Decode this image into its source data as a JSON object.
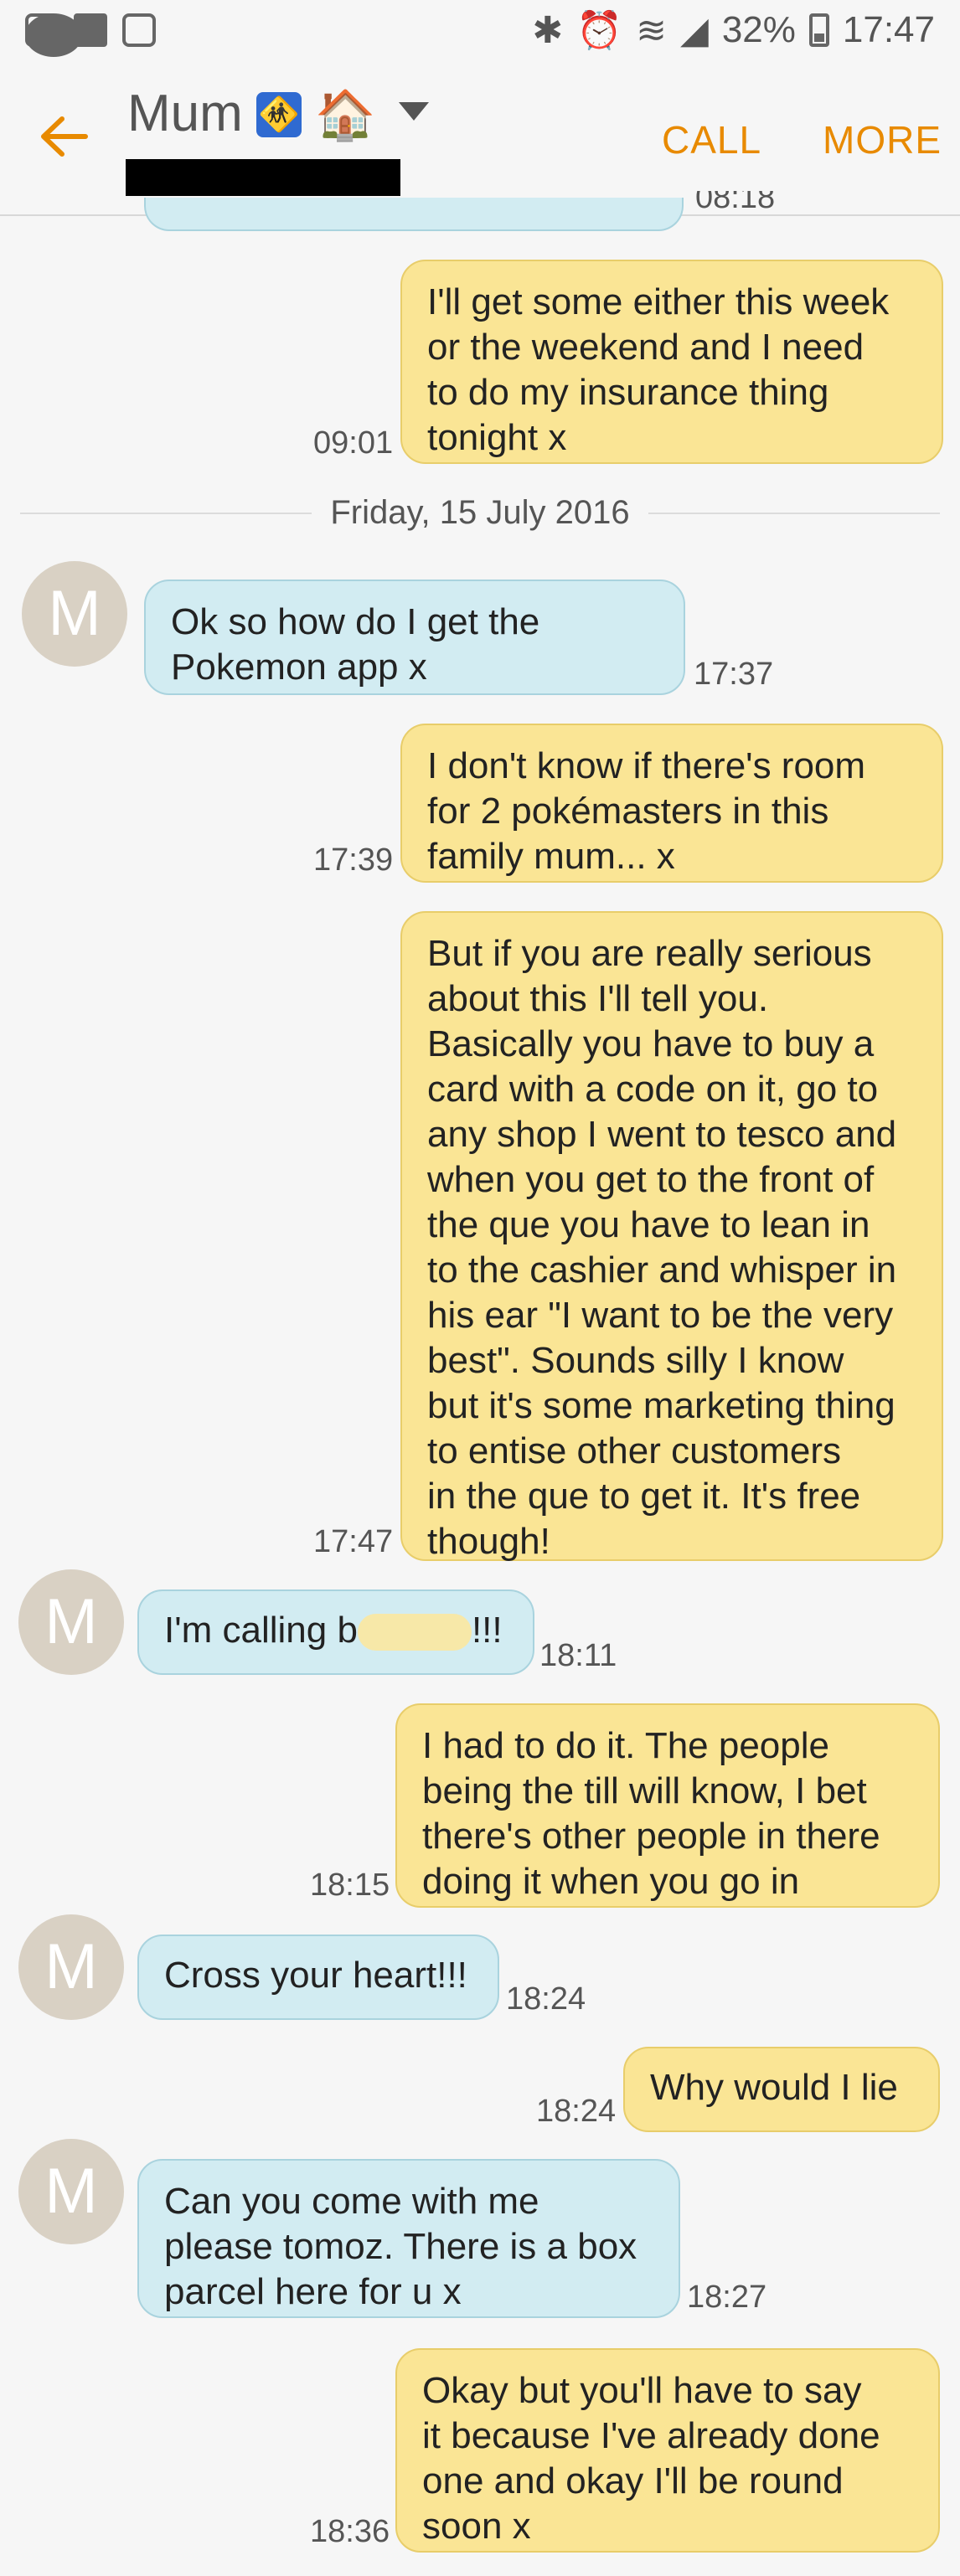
{
  "status_bar": {
    "battery": "32%",
    "time": "17:47",
    "icons": [
      "instagram-icon",
      "facebook-icon",
      "gallery-icon",
      "messenger-icon",
      "bluetooth-icon",
      "alarm-icon",
      "wifi-icon",
      "signal-icon",
      "battery-icon"
    ]
  },
  "header": {
    "contact_name": "Mum",
    "emoji_1": "🚸",
    "emoji_2": "🏠",
    "call_label": "CALL",
    "more_label": "MORE",
    "accent_color": "#e88a00"
  },
  "conversation": {
    "partial_time": "08:18",
    "date_separator": "Friday, 15 July 2016",
    "avatar_letter": "M",
    "messages": [
      {
        "dir": "out",
        "time": "09:01",
        "lines": [
          "I'll get some either this week",
          "or the weekend and I need",
          "to do my insurance thing",
          "tonight x"
        ]
      },
      {
        "dir": "in",
        "time": "17:37",
        "lines": [
          "Ok so how do I get the",
          "Pokemon app x"
        ]
      },
      {
        "dir": "out",
        "time": "17:39",
        "lines": [
          "I don't know if there's room",
          "for 2 pokémasters in this",
          "family mum... x"
        ]
      },
      {
        "dir": "out",
        "time": "17:47",
        "lines": [
          "But if you are really serious",
          "about this I'll tell you.",
          "Basically you have to buy a",
          "card with a code on it, go to",
          "any shop I went to tesco and",
          "when you get to the front of",
          "the que you have to lean in",
          "to the cashier and whisper in",
          "his ear \"I want to be the very",
          "best\". Sounds silly I know",
          "but it's some marketing thing",
          "to entise other customers",
          "in the que to get it. It's free",
          "though!"
        ]
      },
      {
        "dir": "in",
        "time": "18:11",
        "pre": "I'm calling b",
        "post": "!!!"
      },
      {
        "dir": "out",
        "time": "18:15",
        "lines": [
          "I had to do it. The people",
          "being the till will know, I bet",
          "there's other people in there",
          "doing it when you go in"
        ]
      },
      {
        "dir": "in",
        "time": "18:24",
        "lines": [
          "Cross your heart!!!"
        ]
      },
      {
        "dir": "out",
        "time": "18:24",
        "lines": [
          "Why would I lie"
        ]
      },
      {
        "dir": "in",
        "time": "18:27",
        "lines": [
          "Can you come with me",
          "please tomoz. There is a box",
          "parcel here for u x"
        ]
      },
      {
        "dir": "out",
        "time": "18:36",
        "lines": [
          "Okay but you'll have to say",
          "it because I've already done",
          "one and okay I'll be round",
          "soon x"
        ]
      }
    ]
  }
}
